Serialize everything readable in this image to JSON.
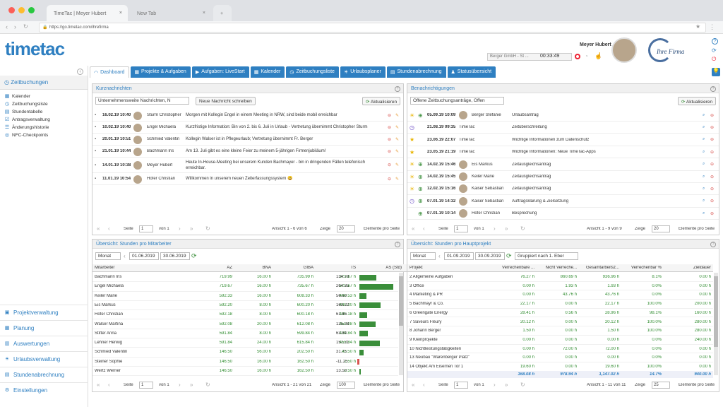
{
  "browser": {
    "tab1": "TimeTac | Meyer Hubert",
    "tab2": "New Tab",
    "url": "https://go.timetac.com/ihrefirma"
  },
  "header": {
    "user": "Meyer Hubert",
    "company": "Berger GmbH - St ...",
    "timer": "00:33:49",
    "logo": "timetac",
    "company_logo": "Ihre Firma"
  },
  "sidebar": {
    "section": "Zeitbuchungen",
    "items": [
      "Kalender",
      "Zeitbuchungsliste",
      "Stundentabelle",
      "Antragsverwaltung",
      "Änderungshistorie",
      "NFC-Checkpoints"
    ],
    "footer": [
      "Projektverwaltung",
      "Planung",
      "Auswertungen",
      "Urlaubsverwaltung",
      "Stundenabrechnung",
      "Einstellungen"
    ]
  },
  "tabs": [
    "Dashboard",
    "Projekte & Aufgaben",
    "Aufgaben: LiveStart",
    "Kalender",
    "Zeitbuchungsliste",
    "Urlaubsplaner",
    "Stundenabrechnung",
    "Statusübersicht"
  ],
  "news": {
    "title": "Kurznachrichten",
    "filter": "Unternehmensweite Nachrichten, N",
    "new_btn": "Neue Nachricht schreiben",
    "refresh": "Aktualisieren",
    "rows": [
      {
        "date": "16.02.19 10:40",
        "name": "Sturm Christopher",
        "text": "Morgen mit Kollegin Engel in einem Meeting in NRW, sind beide mobil erreichbar"
      },
      {
        "date": "10.02.19 10:40",
        "name": "Engel Michaela",
        "text": "Kurzfristige Information: Bin von 2. bis 6. Juli in Urlaub - Vertretung übernimmt Christopher Sturm"
      },
      {
        "date": "20.01.19 10:51",
        "name": "Schmied Valentin",
        "text": "Kollegin Walser ist in Pflegeurlaub; Vertretung übernimmt Fr. Berger"
      },
      {
        "date": "21.01.19 10:44",
        "name": "Bachmann Iris",
        "text": "Am 13. Juli gibt es eine kleine Feier zu meinem 5-jährigen Firmenjubiläum!"
      },
      {
        "date": "14.01.19 10:38",
        "name": "Meyer Hubert",
        "text": "Heute In-House-Meeting bei unserem Kunden Bachmayer - bin in dringenden Fällen telefonisch erreichbar."
      },
      {
        "date": "11.01.19 10:54",
        "name": "Hofer Christian",
        "text": "Willkommen in unserem neuen Zeiterfassungssystem 😀"
      }
    ],
    "pager": {
      "seite": "Seite",
      "page": "1",
      "von": "von 1",
      "ansicht": "Ansicht 1 - 6 von 6",
      "zeige": "Zeige",
      "count": "20",
      "epp": "Elemente pro Seite"
    }
  },
  "notif": {
    "title": "Benachrichtigungen",
    "filter": "Offene Zeitbuchungsanträge, Offen",
    "refresh": "Aktualisieren",
    "rows": [
      {
        "date": "05.09.19 10:09",
        "name": "Berger Stefanie",
        "text": "Urlaubsantrag",
        "icon": "sun"
      },
      {
        "date": "21.08.19 09:35",
        "name": "TimeTac",
        "text": "Zeitüberschreitung",
        "icon": "clock"
      },
      {
        "date": "23.06.19 22:07",
        "name": "TimeTac",
        "text": "Wichtige Informationen zum Datenschutz",
        "icon": "star"
      },
      {
        "date": "23.05.19 21:19",
        "name": "TimeTac",
        "text": "Wichtige Informationen: Neue TimeTac-Apps",
        "icon": "star"
      },
      {
        "date": "14.02.19 15:46",
        "name": "Eis Markus",
        "text": "Zeitausgleichsantrag",
        "icon": "sun"
      },
      {
        "date": "14.02.19 15:45",
        "name": "Keiler Marie",
        "text": "Zeitausgleichsantrag",
        "icon": "sun"
      },
      {
        "date": "12.02.19 15:16",
        "name": "Kaiser Sebastian",
        "text": "Zeitausgleichsantrag",
        "icon": "sun"
      },
      {
        "date": "07.01.19 14:32",
        "name": "Kaiser Sebastian",
        "text": "Auftragsklärung & Zielsetzung",
        "icon": "clock"
      },
      {
        "date": "07.01.19 10:14",
        "name": "Hofer Christian",
        "text": "Besprechung",
        "icon": "none"
      }
    ],
    "pager": {
      "seite": "Seite",
      "page": "1",
      "von": "von 1",
      "ansicht": "Ansicht 1 - 9 von 9",
      "zeige": "Zeige",
      "count": "20",
      "epp": "Elemente pro Seite"
    }
  },
  "emp": {
    "title": "Übersicht: Stunden pro Mitarbeiter",
    "period": "Monat",
    "from": "01.06.2019",
    "to": "30.06.2019",
    "headers": [
      "Mitarbeiter",
      "AZ",
      "BNA",
      "GIBA",
      "TS",
      "AS (Std)"
    ],
    "rows": [
      [
        "Bachmann Iris",
        "719.99",
        "16.00 h",
        "735.99 h",
        "575.67 h",
        "134.78"
      ],
      [
        "Engel Michaela",
        "719.67",
        "16.00 h",
        "735.67 h",
        "575.67 h",
        "264.35"
      ],
      [
        "Keiler Marie",
        "592.33",
        "16.00 h",
        "608.33 h",
        "448.53 h",
        "56.50"
      ],
      [
        "Eis Markus",
        "592.20",
        "8.00 h",
        "600.20 h",
        "440.20 h",
        "163.22"
      ],
      [
        "Hofer Christian",
        "592.18",
        "8.00 h",
        "600.18 h",
        "440.18 h",
        "61.85"
      ],
      [
        "Walser Martina",
        "592.08",
        "20.00 h",
        "612.08 h",
        "452.08 h",
        "125.08"
      ],
      [
        "Stifter Anna",
        "591.84",
        "8.00 h",
        "599.84 h",
        "439.84 h",
        "63.84"
      ],
      [
        "Lehner Herwig",
        "591.84",
        "24.00 h",
        "615.84 h",
        "455.84 h",
        "157.21"
      ],
      [
        "Schmied Valentin",
        "146.50",
        "56.00 h",
        "202.50 h",
        "42.50 h",
        "31.75"
      ],
      [
        "Steiner Sophie",
        "146.50",
        "16.00 h",
        "162.50 h",
        "2.50 h",
        "-11.25"
      ],
      [
        "Wertz Werner",
        "146.50",
        "16.00 h",
        "162.50 h",
        "2.50 h",
        "13.50"
      ]
    ],
    "pager": {
      "seite": "Seite",
      "page": "1",
      "von": "von 1",
      "ansicht": "Ansicht 1 - 21 von 21",
      "zeige": "Zeige",
      "count": "100",
      "epp": "Elemente pro Seite"
    }
  },
  "proj": {
    "title": "Übersicht: Stunden pro Hauptprojekt",
    "period": "Monat",
    "from": "01.09.2019",
    "to": "30.09.2019",
    "group": "Gruppiert nach 1. Eber",
    "headers": [
      "Projekt",
      "Verrechenbare ...",
      "Nicht Verreche...",
      "Gesamtarbeitsz...",
      "Verrechenbar %",
      "Zieldauer"
    ],
    "rows": [
      [
        "2 Allgemeine Aufgaben",
        "76.27 h",
        "860.69 h",
        "936.96 h",
        "8.1%",
        "0.00 h"
      ],
      [
        "3 Office",
        "0.00 h",
        "1.93 h",
        "1.93 h",
        "0.0%",
        "0.00 h"
      ],
      [
        "4 Marketing & PR",
        "0.00 h",
        "43.76 h",
        "43.76 h",
        "0.0%",
        "0.00 h"
      ],
      [
        "5 Bachmayr & Co.",
        "22.17 h",
        "0.00 h",
        "22.17 h",
        "100.0%",
        "200.00 h"
      ],
      [
        "6 Greengate Energy",
        "28.41 h",
        "0.56 h",
        "28.96 h",
        "98.1%",
        "160.00 h"
      ],
      [
        "7 Saveurs Fleury",
        "20.12 h",
        "0.00 h",
        "20.12 h",
        "100.0%",
        "280.00 h"
      ],
      [
        "8 Johann Berger",
        "1.50 h",
        "0.00 h",
        "1.50 h",
        "100.0%",
        "280.00 h"
      ],
      [
        "9 Kleinprojekte",
        "0.00 h",
        "0.00 h",
        "0.00 h",
        "0.0%",
        "240.00 h"
      ],
      [
        "10 Nichtleistungstätigkeiten",
        "0.00 h",
        "72.00 h",
        "72.00 h",
        "0.0%",
        "0.00 h"
      ],
      [
        "13 Neubau \"Warenberger Platz\"",
        "0.00 h",
        "0.00 h",
        "0.00 h",
        "0.0%",
        "0.00 h"
      ],
      [
        "14 Objekt Am Eisernen Tor 1",
        "19.60 h",
        "0.00 h",
        "19.60 h",
        "100.0%",
        "0.00 h"
      ]
    ],
    "total": [
      "",
      "168.08 h",
      "978.94 h",
      "1,147.02 h",
      "14.7%",
      "940.00 h"
    ],
    "pager": {
      "seite": "Seite",
      "page": "1",
      "von": "von 1",
      "ansicht": "Ansicht 1 - 11 von 11",
      "zeige": "Zeige",
      "count": "25",
      "epp": "Elemente pro Seite"
    }
  },
  "colors": {
    "accent": "#2e7fc1",
    "bar": "#3a8e3a",
    "neg": "#d9534f"
  }
}
